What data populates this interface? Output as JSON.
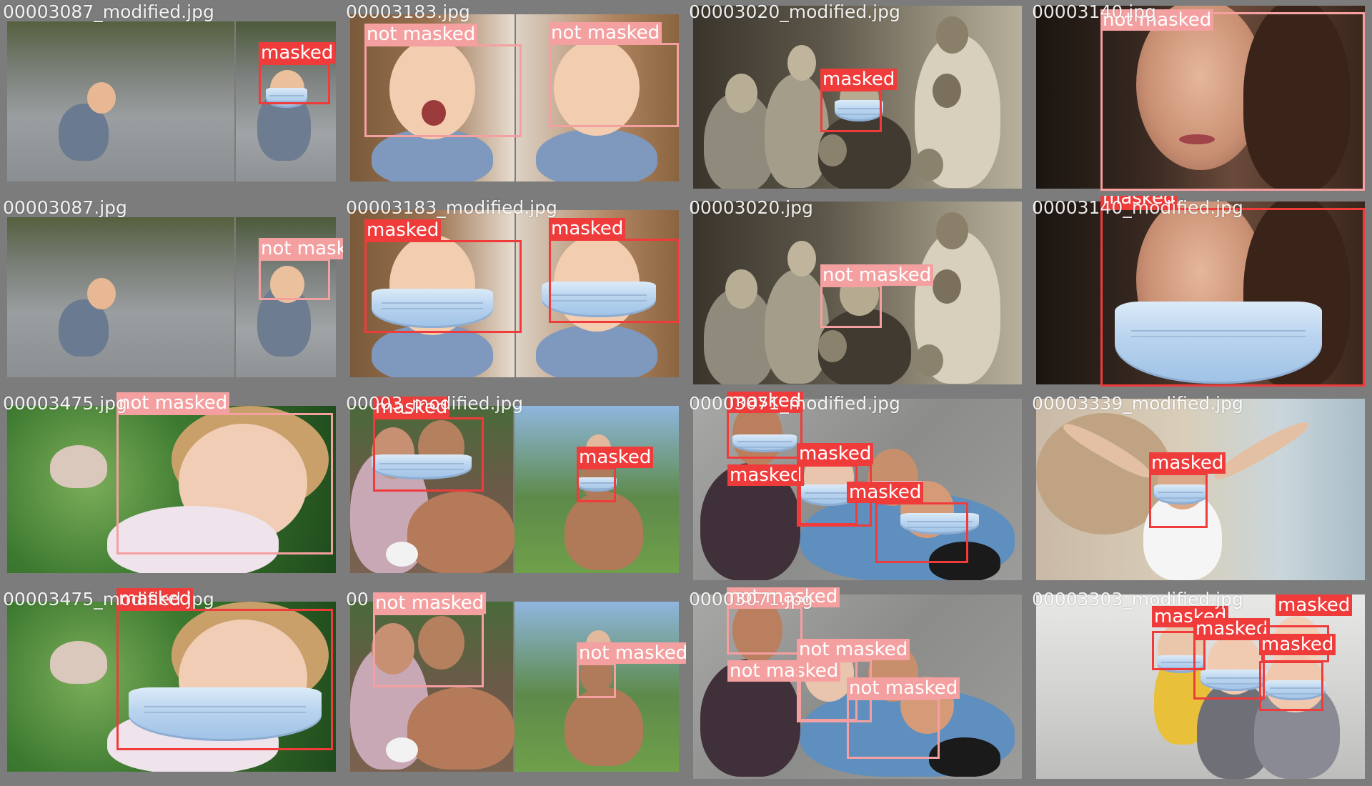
{
  "colors": {
    "tile_frame": "#7c7c7c",
    "masked": "#f03b3b",
    "not_masked": "#f5a0a0",
    "filename_text": "#ffffff"
  },
  "tiles": [
    {
      "file": "00003087_modified.jpg",
      "detections": [
        {
          "label": "masked"
        }
      ]
    },
    {
      "file": "00003183.jpg",
      "detections": [
        {
          "label": "not masked"
        },
        {
          "label": "not masked"
        }
      ]
    },
    {
      "file": "00003020_modified.jpg",
      "detections": [
        {
          "label": "masked"
        }
      ]
    },
    {
      "file": "00003140.jpg",
      "detections": [
        {
          "label": "not masked"
        }
      ]
    },
    {
      "file": "00003087.jpg",
      "detections": [
        {
          "label": "not masked"
        }
      ]
    },
    {
      "file": "00003183_modified.jpg",
      "detections": [
        {
          "label": "masked"
        },
        {
          "label": "masked"
        }
      ]
    },
    {
      "file": "00003020.jpg",
      "detections": [
        {
          "label": "not masked"
        }
      ]
    },
    {
      "file": "00003140_modified.jpg",
      "detections": [
        {
          "label": "masked"
        }
      ]
    },
    {
      "file": "00003475.jpg",
      "detections": [
        {
          "label": "not masked"
        }
      ]
    },
    {
      "file": "00003_modified.jpg",
      "detections": [
        {
          "label": "masked"
        },
        {
          "label": "masked"
        }
      ]
    },
    {
      "file": "00003071_modified.jpg",
      "detections": [
        {
          "label": "masked"
        },
        {
          "label": "masked"
        },
        {
          "label": "masked"
        },
        {
          "label": "masked"
        }
      ]
    },
    {
      "file": "00003339_modified.jpg",
      "detections": [
        {
          "label": "masked"
        }
      ]
    },
    {
      "file": "00003475_modified.jpg",
      "detections": [
        {
          "label": "masked"
        }
      ]
    },
    {
      "file": "00",
      "detections": [
        {
          "label": "not masked"
        },
        {
          "label": "not masked"
        }
      ]
    },
    {
      "file": "00003071.jpg",
      "detections": [
        {
          "label": "not masked"
        },
        {
          "label": "not masked"
        },
        {
          "label": "not masked"
        },
        {
          "label": "not masked"
        }
      ]
    },
    {
      "file": "00003303_modified.jpg",
      "detections": [
        {
          "label": "masked"
        },
        {
          "label": "masked"
        },
        {
          "label": "masked"
        },
        {
          "label": "masked"
        }
      ]
    }
  ]
}
